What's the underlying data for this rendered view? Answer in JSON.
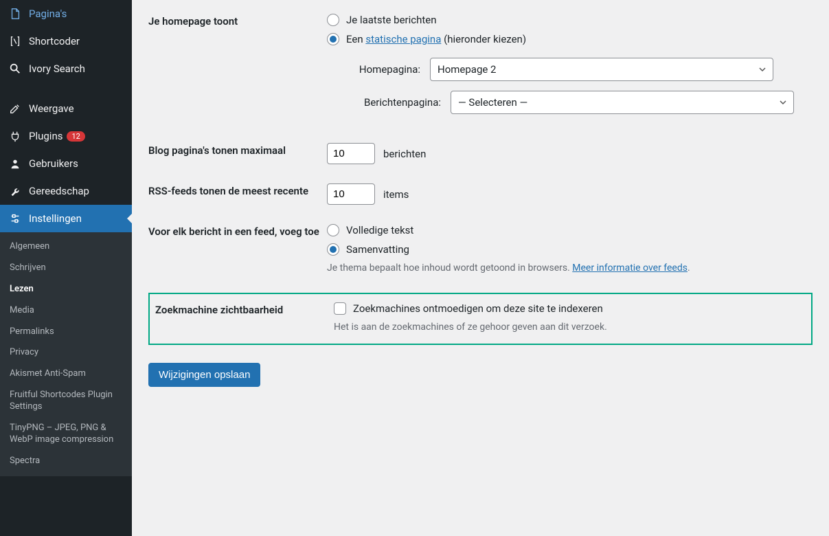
{
  "sidebar": {
    "items": [
      {
        "label": "Pagina's"
      },
      {
        "label": "Shortcoder"
      },
      {
        "label": "Ivory Search"
      },
      {
        "label": "Weergave"
      },
      {
        "label": "Plugins",
        "badge": "12"
      },
      {
        "label": "Gebruikers"
      },
      {
        "label": "Gereedschap"
      },
      {
        "label": "Instellingen"
      }
    ],
    "submenu": [
      {
        "label": "Algemeen"
      },
      {
        "label": "Schrijven"
      },
      {
        "label": "Lezen"
      },
      {
        "label": "Media"
      },
      {
        "label": "Permalinks"
      },
      {
        "label": "Privacy"
      },
      {
        "label": "Akismet Anti-Spam"
      },
      {
        "label": "Fruitful Shortcodes Plugin Settings"
      },
      {
        "label": "TinyPNG – JPEG, PNG & WebP image compression"
      },
      {
        "label": "Spectra"
      }
    ]
  },
  "form": {
    "homepage": {
      "label": "Je homepage toont",
      "opt1": "Je laatste berichten",
      "opt2_prefix": "Een ",
      "opt2_link": "statische pagina",
      "opt2_suffix": " (hieronder kiezen)",
      "homepage_label": "Homepagina:",
      "homepage_value": "Homepage 2",
      "posts_label": "Berichtenpagina:",
      "posts_value": "— Selecteren —"
    },
    "blog_max": {
      "label": "Blog pagina's tonen maximaal",
      "value": "10",
      "suffix": "berichten"
    },
    "rss": {
      "label": "RSS-feeds tonen de meest recente",
      "value": "10",
      "suffix": "items"
    },
    "feed_content": {
      "label": "Voor elk bericht in een feed, voeg toe",
      "opt1": "Volledige tekst",
      "opt2": "Samenvatting",
      "desc_prefix": "Je thema bepaalt hoe inhoud wordt getoond in browsers. ",
      "desc_link": "Meer informatie over feeds",
      "desc_suffix": "."
    },
    "search": {
      "label": "Zoekmachine zichtbaarheid",
      "check_label": "Zoekmachines ontmoedigen om deze site te indexeren",
      "desc": "Het is aan de zoekmachines of ze gehoor geven aan dit verzoek."
    },
    "submit": "Wijzigingen opslaan"
  }
}
